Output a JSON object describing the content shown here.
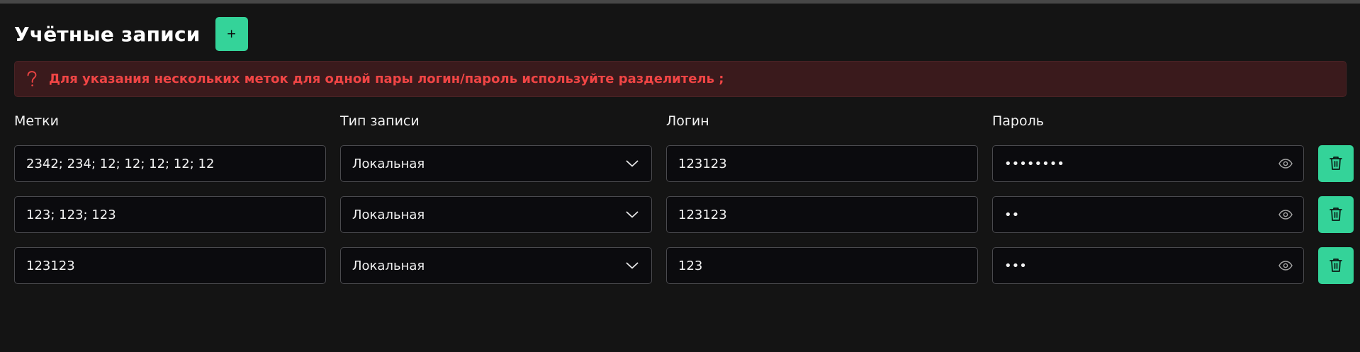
{
  "header": {
    "title": "Учётные записи",
    "add_label": "+"
  },
  "hint": {
    "icon": "question-icon",
    "text": "Для указания нескольких меток для одной пары логин/пароль используйте разделитель ;"
  },
  "columns": {
    "tags": "Метки",
    "type": "Тип записи",
    "login": "Логин",
    "password": "Пароль"
  },
  "accounts": [
    {
      "tags": "2342; 234; 12; 12; 12; 12; 12",
      "type": "Локальная",
      "login": "123123",
      "password_mask": "••••••••"
    },
    {
      "tags": "123; 123; 123",
      "type": "Локальная",
      "login": "123123",
      "password_mask": "••"
    },
    {
      "tags": "123123",
      "type": "Локальная",
      "login": "123",
      "password_mask": "•••"
    }
  ],
  "colors": {
    "background": "#141414",
    "accent": "#34d399",
    "danger_text": "#f04545",
    "danger_bg": "#3a1a1c",
    "field_bg": "#0b0b0e",
    "field_border": "#4a4a4e"
  }
}
